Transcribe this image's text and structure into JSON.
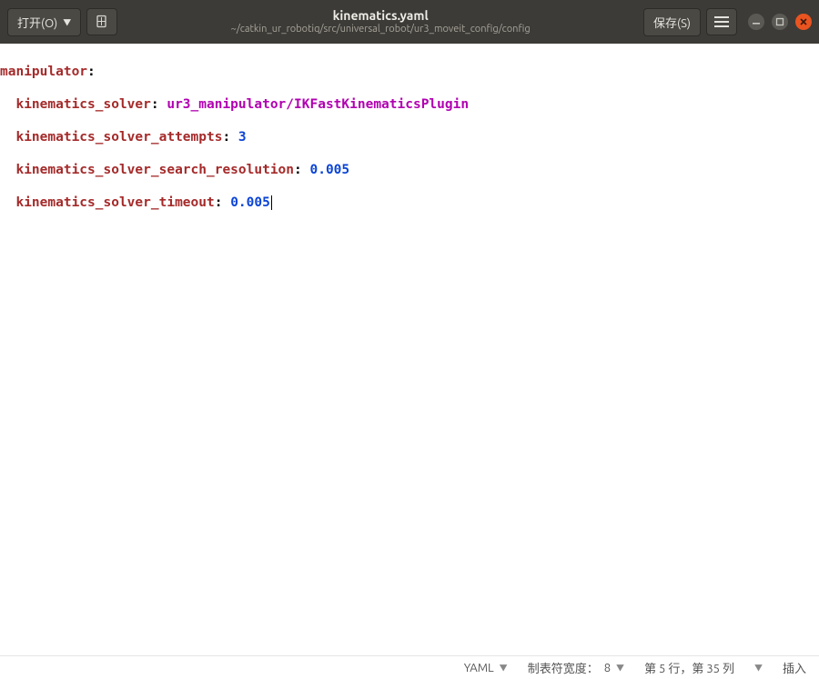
{
  "titlebar": {
    "open_label": "打开(O)",
    "save_label": "保存(S)",
    "title": "kinematics.yaml",
    "subtitle": "~/catkin_ur_robotiq/src/universal_robot/ur3_moveit_config/config"
  },
  "code": {
    "line1_key": "manipulator",
    "indent": "  ",
    "line2_key": "kinematics_solver",
    "line2_val": "ur3_manipulator/IKFastKinematicsPlugin",
    "line3_key": "kinematics_solver_attempts",
    "line3_val": "3",
    "line4_key": "kinematics_solver_search_resolution",
    "line4_val": "0.005",
    "line5_key": "kinematics_solver_timeout",
    "line5_val": "0.005"
  },
  "statusbar": {
    "lang": "YAML",
    "tabwidth_label": "制表符宽度：",
    "tabwidth_value": "8",
    "cursor_pos": "第 5 行，第 35 列",
    "mode": "插入"
  }
}
